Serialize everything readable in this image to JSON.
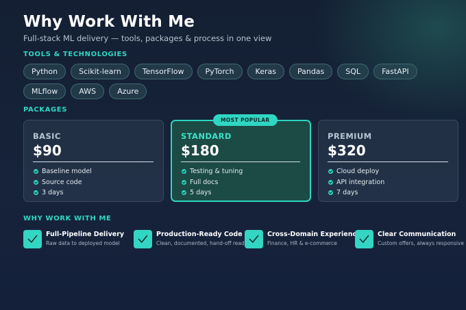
{
  "header": {
    "title": "Why Work With Me",
    "subtitle": "Full-stack ML delivery — tools, packages & process in one view"
  },
  "tools": {
    "title": "TOOLS & TECHNOLOGIES",
    "items": [
      "Python",
      "Scikit-learn",
      "TensorFlow",
      "PyTorch",
      "Keras",
      "Pandas",
      "SQL",
      "FastAPI",
      "MLflow",
      "AWS",
      "Azure"
    ]
  },
  "packages": {
    "title": "PACKAGES",
    "items": [
      {
        "name": "BASIC",
        "price": "$90",
        "features": [
          "Baseline model",
          "Source code",
          "3 days"
        ]
      },
      {
        "name": "STANDARD",
        "price": "$180",
        "badge": "MOST POPULAR",
        "features": [
          "Testing & tuning",
          "Full docs",
          "5 days"
        ]
      },
      {
        "name": "PREMIUM",
        "price": "$320",
        "features": [
          "Cloud deploy",
          "API integration",
          "7 days"
        ]
      }
    ]
  },
  "why": {
    "title": "WHY WORK WITH ME",
    "items": [
      {
        "icon": "check-icon",
        "title": "Full-Pipeline Delivery",
        "desc": "Raw data to deployed model"
      },
      {
        "icon": "check-icon",
        "title": "Production-Ready Code",
        "desc": "Clean, documented, hand-off ready"
      },
      {
        "icon": "check-icon",
        "title": "Cross-Domain Experience",
        "desc": "Finance, HR & e-commerce"
      },
      {
        "icon": "check-icon",
        "title": "Clear Communication",
        "desc": "Custom offers, always responsive"
      }
    ]
  },
  "colors": {
    "accent": "#2fd6c2",
    "background": "#16233a",
    "featured_card": "#1c4a45"
  }
}
